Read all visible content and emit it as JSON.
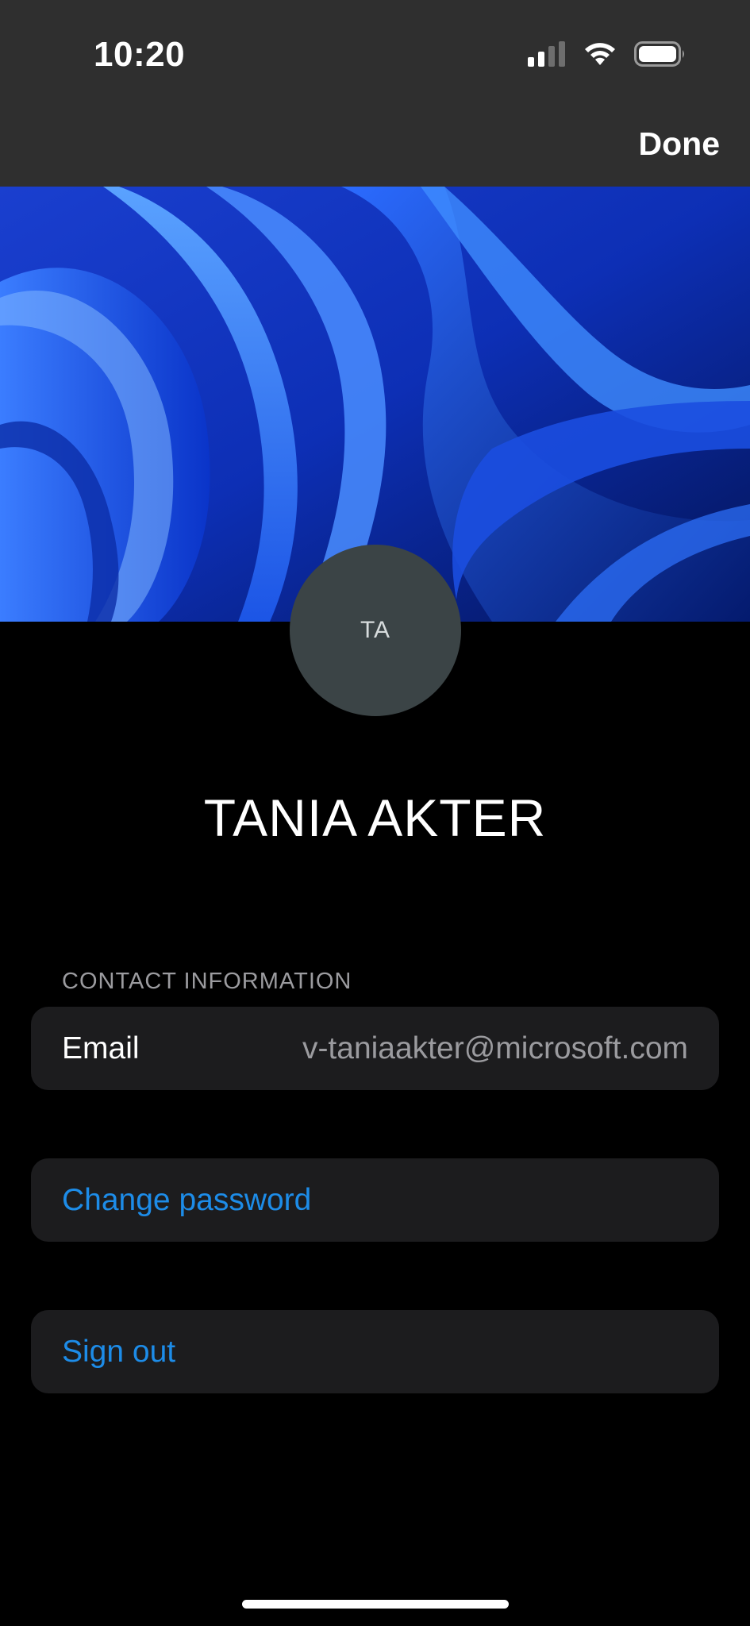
{
  "status_bar": {
    "time": "10:20",
    "icons": [
      "cellular-signal-icon",
      "wifi-icon",
      "battery-icon"
    ]
  },
  "nav": {
    "done_label": "Done"
  },
  "profile": {
    "initials": "TA",
    "name": "TANIA AKTER"
  },
  "contact": {
    "section_title": "CONTACT INFORMATION",
    "email_label": "Email",
    "email_value": "v-taniaakter@microsoft.com"
  },
  "actions": {
    "change_password": "Change password",
    "sign_out": "Sign out"
  },
  "colors": {
    "background": "#000000",
    "header": "#2f2f2f",
    "card": "#1c1c1e",
    "link": "#1d8ce8",
    "secondary_text": "#9b9b9f",
    "avatar": "#3b4446"
  }
}
